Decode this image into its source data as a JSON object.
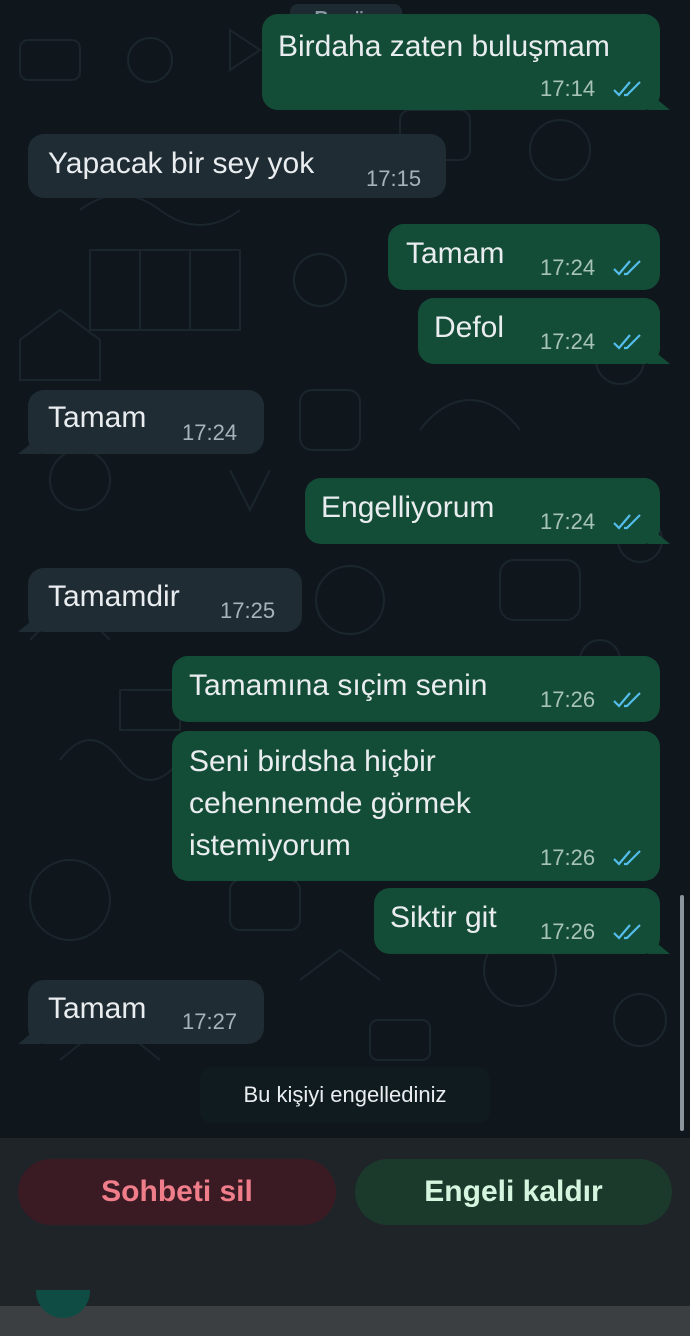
{
  "date_chip": "Bugün",
  "messages": [
    {
      "id": "m1",
      "direction": "out",
      "text": "Birdaha zaten buluşmam",
      "time": "17:14"
    },
    {
      "id": "m2",
      "direction": "in",
      "text": "Yapacak bir sey yok",
      "time": "17:15"
    },
    {
      "id": "m3",
      "direction": "out",
      "text": "Tamam",
      "time": "17:24"
    },
    {
      "id": "m4",
      "direction": "out",
      "text": "Defol",
      "time": "17:24"
    },
    {
      "id": "m5",
      "direction": "in",
      "text": "Tamam",
      "time": "17:24"
    },
    {
      "id": "m6",
      "direction": "out",
      "text": "Engelliyorum",
      "time": "17:24"
    },
    {
      "id": "m7",
      "direction": "in",
      "text": "Tamamdir",
      "time": "17:25"
    },
    {
      "id": "m8",
      "direction": "out",
      "text": "Tamamına sıçim senin",
      "time": "17:26"
    },
    {
      "id": "m9",
      "direction": "out",
      "lines": [
        "Seni birdsha hiçbir",
        "cehennemde görmek",
        "istemiyorum"
      ],
      "time": "17:26"
    },
    {
      "id": "m10",
      "direction": "out",
      "text": "Siktir git",
      "time": "17:26"
    },
    {
      "id": "m11",
      "direction": "in",
      "text": "Tamam",
      "time": "17:27"
    }
  ],
  "system_message": "Bu kişiyi engellediniz",
  "actions": {
    "delete_chat": "Sohbeti sil",
    "unblock": "Engeli kaldır"
  },
  "colors": {
    "chat_background": "#0f171d",
    "outgoing_bubble": "#144d37",
    "incoming_bubble": "#1f2c34",
    "read_ticks": "#53bdeb",
    "delete_text": "#f07d8a",
    "unblock_text": "#d6f5df"
  },
  "icons": {
    "read_receipt": "double-check-icon"
  }
}
